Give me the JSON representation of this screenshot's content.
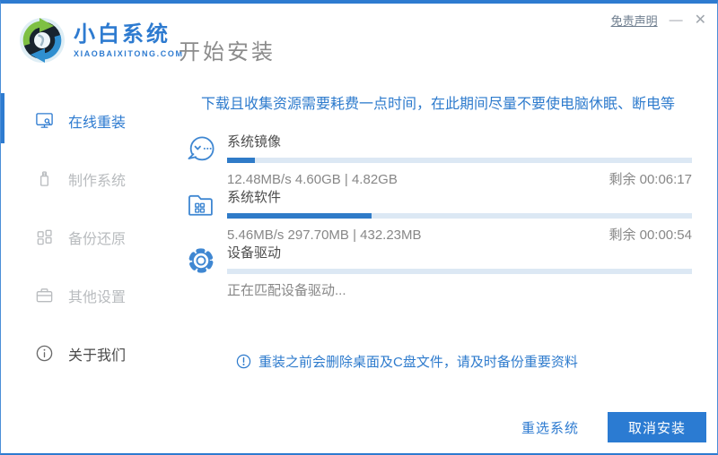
{
  "brand": {
    "name": "小白系统",
    "domain": "XIAOBAIXITONG.COM"
  },
  "page_title": "开始安装",
  "titlebar": {
    "disclaimer": "免责声明",
    "minimize": "—",
    "close": "✕"
  },
  "sidebar": {
    "items": [
      {
        "label": "在线重装",
        "icon": "monitor-icon",
        "active": true
      },
      {
        "label": "制作系统",
        "icon": "usb-drive-icon",
        "active": false
      },
      {
        "label": "备份还原",
        "icon": "backup-grid-icon",
        "active": false
      },
      {
        "label": "其他设置",
        "icon": "toolbox-icon",
        "active": false
      },
      {
        "label": "关于我们",
        "icon": "info-icon",
        "active": false
      }
    ]
  },
  "main": {
    "warning": "下载且收集资源需要耗费一点时间，在此期间尽量不要使电脑休眠、断电等",
    "tasks": [
      {
        "title": "系统镜像",
        "icon": "mascot-chat-icon",
        "progress": "6%",
        "stats": "12.48MB/s 4.60GB | 4.82GB",
        "remaining": "剩余 00:06:17"
      },
      {
        "title": "系统软件",
        "icon": "folder-software-icon",
        "progress": "31%",
        "stats": "5.46MB/s 297.70MB | 432.23MB",
        "remaining": "剩余 00:00:54"
      },
      {
        "title": "设备驱动",
        "icon": "gear-icon",
        "progress": "0%",
        "stats": "正在匹配设备驱动...",
        "remaining": ""
      }
    ],
    "note": "重装之前会删除桌面及C盘文件，请及时备份重要资料"
  },
  "footer": {
    "reselect": "重选系统",
    "cancel": "取消安装"
  },
  "colors": {
    "accent": "#2e7bd0",
    "progress_fill": "#2f7bc8",
    "progress_track": "#dce8f4",
    "warning_text": "#2e7bcd",
    "inactive_text": "#b9bcbf",
    "button_bg": "#2b7bd2"
  }
}
